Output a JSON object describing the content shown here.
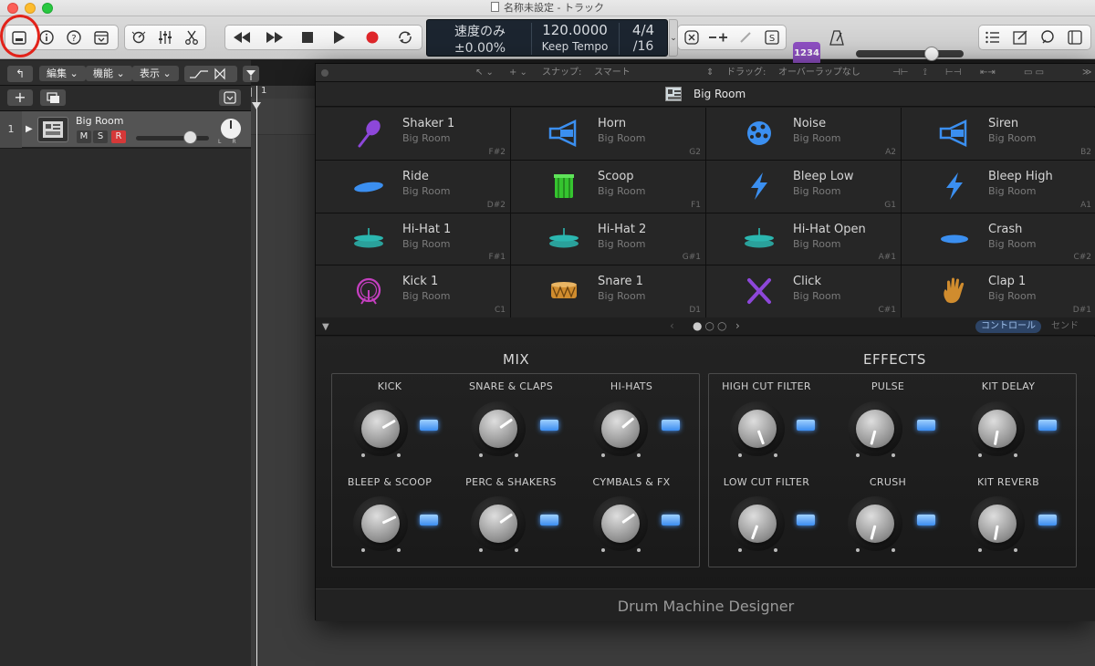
{
  "window": {
    "title": "名称未設定 - トラック"
  },
  "toolbar": {
    "lcd": {
      "mode_label": "速度のみ",
      "offset": "±0.00%",
      "tempo": "120.0000",
      "tempo_mode": "Keep Tempo",
      "signature": "4/4",
      "division": "/16"
    },
    "cpu_label": "1234",
    "master_volume_level": 0.68
  },
  "tracks_header": {
    "menus": [
      "編集",
      "機能",
      "表示"
    ]
  },
  "track": {
    "number": "1",
    "name": "Big Room",
    "mute": "M",
    "solo": "S",
    "record": "R"
  },
  "ruler": {
    "bar": "1"
  },
  "plugin": {
    "toolbar_texts": [
      "スナップ:",
      "スマート",
      "ドラッグ:",
      "オーバーラップなし"
    ],
    "kit_name": "Big Room",
    "pads": [
      {
        "name": "Shaker 1",
        "kit": "Big Room",
        "note": "F#2",
        "icon": "shaker-icon",
        "color": "#8d47d9"
      },
      {
        "name": "Horn",
        "kit": "Big Room",
        "note": "G2",
        "icon": "horn-icon",
        "color": "#3b8ff0"
      },
      {
        "name": "Noise",
        "kit": "Big Room",
        "note": "A2",
        "icon": "noise-icon",
        "color": "#3b8ff0"
      },
      {
        "name": "Siren",
        "kit": "Big Room",
        "note": "B2",
        "icon": "siren-icon",
        "color": "#3b8ff0"
      },
      {
        "name": "Ride",
        "kit": "Big Room",
        "note": "D#2",
        "icon": "ride-cymbal-icon",
        "color": "#3b8ff0"
      },
      {
        "name": "Scoop",
        "kit": "Big Room",
        "note": "F1",
        "icon": "drum-green-icon",
        "color": "#35c42f"
      },
      {
        "name": "Bleep Low",
        "kit": "Big Room",
        "note": "G1",
        "icon": "lightning-icon",
        "color": "#3b8ff0"
      },
      {
        "name": "Bleep High",
        "kit": "Big Room",
        "note": "A1",
        "icon": "lightning-icon",
        "color": "#3b8ff0"
      },
      {
        "name": "Hi-Hat 1",
        "kit": "Big Room",
        "note": "F#1",
        "icon": "hihat-icon",
        "color": "#2bb7b0"
      },
      {
        "name": "Hi-Hat 2",
        "kit": "Big Room",
        "note": "G#1",
        "icon": "hihat-icon",
        "color": "#2bb7b0"
      },
      {
        "name": "Hi-Hat Open",
        "kit": "Big Room",
        "note": "A#1",
        "icon": "hihat-icon",
        "color": "#2bb7b0"
      },
      {
        "name": "Crash",
        "kit": "Big Room",
        "note": "C#2",
        "icon": "crash-cymbal-icon",
        "color": "#3b8ff0"
      },
      {
        "name": "Kick 1",
        "kit": "Big Room",
        "note": "C1",
        "icon": "kick-drum-icon",
        "color": "#c43fbf"
      },
      {
        "name": "Snare 1",
        "kit": "Big Room",
        "note": "D1",
        "icon": "snare-drum-icon",
        "color": "#d08c2e"
      },
      {
        "name": "Click",
        "kit": "Big Room",
        "note": "C#1",
        "icon": "sticks-icon",
        "color": "#8d47d9"
      },
      {
        "name": "Clap 1",
        "kit": "Big Room",
        "note": "D#1",
        "icon": "hand-icon",
        "color": "#d08c2e"
      }
    ],
    "tabs": {
      "control": "コントロール",
      "send": "センド"
    },
    "mix": {
      "title": "MIX",
      "knobs": [
        {
          "label": "KICK",
          "angle": 60
        },
        {
          "label": "SNARE & CLAPS",
          "angle": 55
        },
        {
          "label": "HI-HATS",
          "angle": 50
        },
        {
          "label": "BLEEP & SCOOP",
          "angle": 65
        },
        {
          "label": "PERC & SHAKERS",
          "angle": 55
        },
        {
          "label": "CYMBALS & FX",
          "angle": 55
        }
      ]
    },
    "effects": {
      "title": "EFFECTS",
      "knobs": [
        {
          "label": "HIGH CUT FILTER",
          "angle": 160
        },
        {
          "label": "PULSE",
          "angle": 195
        },
        {
          "label": "KIT DELAY",
          "angle": 190
        },
        {
          "label": "LOW CUT FILTER",
          "angle": 200
        },
        {
          "label": "CRUSH",
          "angle": 195
        },
        {
          "label": "KIT REVERB",
          "angle": 190
        }
      ]
    },
    "footer_title": "Drum Machine Designer"
  }
}
